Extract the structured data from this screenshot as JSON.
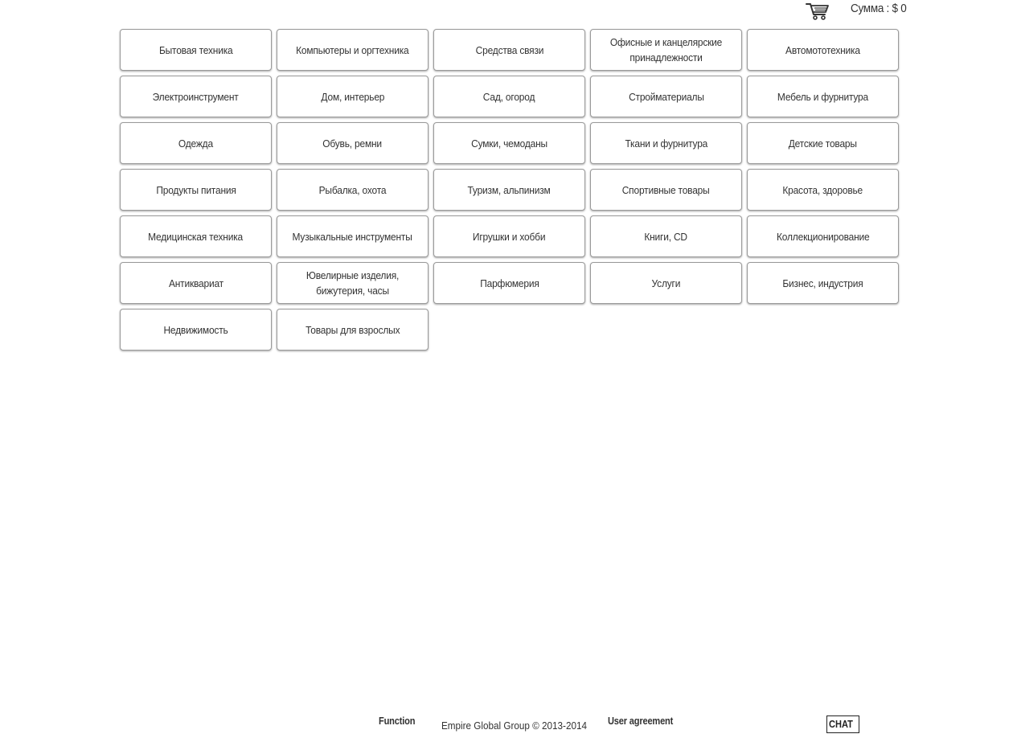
{
  "header": {
    "cart_icon": "shopping-cart-icon",
    "cart_sum": "Сумма : $ 0"
  },
  "categories": [
    "Бытовая техника",
    "Компьютеры и оргтехника",
    "Средства связи",
    "Офисные и канцелярские принадлежности",
    "Автомототехника",
    "Электроинструмент",
    "Дом, интерьер",
    "Сад, огород",
    "Стройматериалы",
    "Мебель и фурнитура",
    "Одежда",
    "Обувь, ремни",
    "Сумки, чемоданы",
    "Ткани и фурнитура",
    "Детские товары",
    "Продукты питания",
    "Рыбалка, охота",
    "Туризм, альпинизм",
    "Спортивные товары",
    "Красота, здоровье",
    "Медицинская техника",
    "Музыкальные инструменты",
    "Игрушки и хобби",
    "Книги, CD",
    "Коллекционирование",
    "Антиквариат",
    "Ювелирные изделия, бижутерия, часы",
    "Парфюмерия",
    "Услуги",
    "Бизнес, индустрия",
    "Недвижимость",
    "Товары для взрослых"
  ],
  "footer": {
    "function_label": "Function",
    "copyright": "Empire Global Group © 2013-2014",
    "user_agreement_label": "User agreement",
    "chat_label": "CHAT"
  }
}
